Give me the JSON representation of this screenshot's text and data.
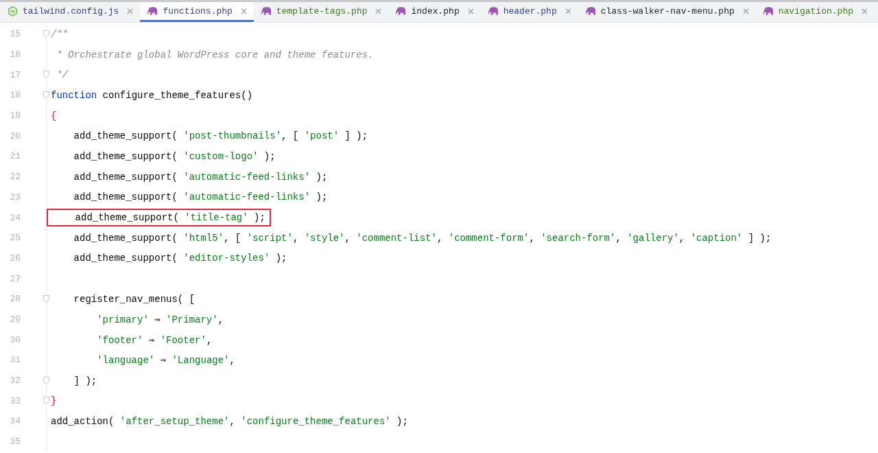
{
  "tabs": [
    {
      "label": "tailwind.config.js",
      "kind": "node",
      "selected": false,
      "color": "#2e3f8f"
    },
    {
      "label": "functions.php",
      "kind": "php",
      "selected": true,
      "color": "#2e3f8f"
    },
    {
      "label": "template-tags.php",
      "kind": "php",
      "selected": false,
      "color": "#3a7d1e"
    },
    {
      "label": "index.php",
      "kind": "php",
      "selected": false,
      "color": "#1f1f1f"
    },
    {
      "label": "header.php",
      "kind": "php",
      "selected": false,
      "color": "#2e3f8f"
    },
    {
      "label": "class-walker-nav-menu.php",
      "kind": "php",
      "selected": false,
      "color": "#1f1f1f"
    },
    {
      "label": "navigation.php",
      "kind": "php",
      "selected": false,
      "color": "#3a7d1e"
    }
  ],
  "editor": {
    "lines": [
      {
        "number": "15",
        "fold": true,
        "highlighted": false,
        "tokens": [
          {
            "kind": "comment",
            "text": "/**"
          }
        ]
      },
      {
        "number": "16",
        "fold": false,
        "highlighted": false,
        "tokens": [
          {
            "kind": "comment",
            "text": " * Orchestrate global WordPress core and theme features."
          }
        ]
      },
      {
        "number": "17",
        "fold": true,
        "highlighted": false,
        "tokens": [
          {
            "kind": "comment",
            "text": " */"
          }
        ]
      },
      {
        "number": "18",
        "fold": true,
        "highlighted": false,
        "tokens": [
          {
            "kind": "keyword",
            "text": "function"
          },
          {
            "kind": "plain",
            "text": " configure_theme_features()"
          }
        ]
      },
      {
        "number": "19",
        "fold": false,
        "highlighted": false,
        "tokens": [
          {
            "kind": "brace",
            "text": "{"
          }
        ]
      },
      {
        "number": "20",
        "fold": false,
        "highlighted": false,
        "tokens": [
          {
            "kind": "plain",
            "text": "    add_theme_support( "
          },
          {
            "kind": "string",
            "text": "'post-thumbnails'"
          },
          {
            "kind": "plain",
            "text": ", [ "
          },
          {
            "kind": "string",
            "text": "'post'"
          },
          {
            "kind": "plain",
            "text": " ] );"
          }
        ]
      },
      {
        "number": "21",
        "fold": false,
        "highlighted": false,
        "tokens": [
          {
            "kind": "plain",
            "text": "    add_theme_support( "
          },
          {
            "kind": "string",
            "text": "'custom-logo'"
          },
          {
            "kind": "plain",
            "text": " );"
          }
        ]
      },
      {
        "number": "22",
        "fold": false,
        "highlighted": false,
        "tokens": [
          {
            "kind": "plain",
            "text": "    add_theme_support( "
          },
          {
            "kind": "string",
            "text": "'automatic-feed-links'"
          },
          {
            "kind": "plain",
            "text": " );"
          }
        ]
      },
      {
        "number": "23",
        "fold": false,
        "highlighted": false,
        "tokens": [
          {
            "kind": "plain",
            "text": "    add_theme_support( "
          },
          {
            "kind": "string",
            "text": "'automatic-feed-links'"
          },
          {
            "kind": "plain",
            "text": " );"
          }
        ]
      },
      {
        "number": "24",
        "fold": false,
        "highlighted": true,
        "tokens": [
          {
            "kind": "plain",
            "text": "    add_theme_support( "
          },
          {
            "kind": "string",
            "text": "'title-tag'"
          },
          {
            "kind": "plain",
            "text": " );"
          }
        ]
      },
      {
        "number": "25",
        "fold": false,
        "highlighted": false,
        "tokens": [
          {
            "kind": "plain",
            "text": "    add_theme_support( "
          },
          {
            "kind": "string",
            "text": "'html5'"
          },
          {
            "kind": "plain",
            "text": ", [ "
          },
          {
            "kind": "string",
            "text": "'script'"
          },
          {
            "kind": "plain",
            "text": ", "
          },
          {
            "kind": "string",
            "text": "'style'"
          },
          {
            "kind": "plain",
            "text": ", "
          },
          {
            "kind": "string",
            "text": "'comment-list'"
          },
          {
            "kind": "plain",
            "text": ", "
          },
          {
            "kind": "string",
            "text": "'comment-form'"
          },
          {
            "kind": "plain",
            "text": ", "
          },
          {
            "kind": "string",
            "text": "'search-form'"
          },
          {
            "kind": "plain",
            "text": ", "
          },
          {
            "kind": "string",
            "text": "'gallery'"
          },
          {
            "kind": "plain",
            "text": ", "
          },
          {
            "kind": "string",
            "text": "'caption'"
          },
          {
            "kind": "plain",
            "text": " ] );"
          }
        ]
      },
      {
        "number": "26",
        "fold": false,
        "highlighted": false,
        "tokens": [
          {
            "kind": "plain",
            "text": "    add_theme_support( "
          },
          {
            "kind": "string",
            "text": "'editor-styles'"
          },
          {
            "kind": "plain",
            "text": " );"
          }
        ]
      },
      {
        "number": "27",
        "fold": false,
        "highlighted": false
      },
      {
        "number": "28",
        "fold": true,
        "highlighted": false,
        "tokens": [
          {
            "kind": "plain",
            "text": "    register_nav_menus( ["
          }
        ]
      },
      {
        "number": "29",
        "fold": false,
        "highlighted": false,
        "tokens": [
          {
            "kind": "string",
            "text": "        'primary'"
          },
          {
            "kind": "plain",
            "text": " ⇒ "
          },
          {
            "kind": "string",
            "text": "'Primary'"
          },
          {
            "kind": "plain",
            "text": ","
          }
        ]
      },
      {
        "number": "30",
        "fold": false,
        "highlighted": false,
        "tokens": [
          {
            "kind": "string",
            "text": "        'footer'"
          },
          {
            "kind": "plain",
            "text": " ⇒ "
          },
          {
            "kind": "string",
            "text": "'Footer'"
          },
          {
            "kind": "plain",
            "text": ","
          }
        ]
      },
      {
        "number": "31",
        "fold": false,
        "highlighted": false,
        "tokens": [
          {
            "kind": "string",
            "text": "        'language'"
          },
          {
            "kind": "plain",
            "text": " ⇒ "
          },
          {
            "kind": "string",
            "text": "'Language'"
          },
          {
            "kind": "plain",
            "text": ","
          }
        ]
      },
      {
        "number": "32",
        "fold": true,
        "highlighted": false,
        "tokens": [
          {
            "kind": "plain",
            "text": "    ] );"
          }
        ]
      },
      {
        "number": "33",
        "fold": true,
        "highlighted": false,
        "tokens": [
          {
            "kind": "brace",
            "text": "}"
          }
        ]
      },
      {
        "number": "34",
        "fold": false,
        "highlighted": false,
        "tokens": [
          {
            "kind": "plain",
            "text": "add_action( "
          },
          {
            "kind": "string",
            "text": "'after_setup_theme'"
          },
          {
            "kind": "plain",
            "text": ", "
          },
          {
            "kind": "string",
            "text": "'configure_theme_features'"
          },
          {
            "kind": "plain",
            "text": " );"
          }
        ]
      },
      {
        "number": "35",
        "fold": false,
        "highlighted": false
      }
    ]
  }
}
